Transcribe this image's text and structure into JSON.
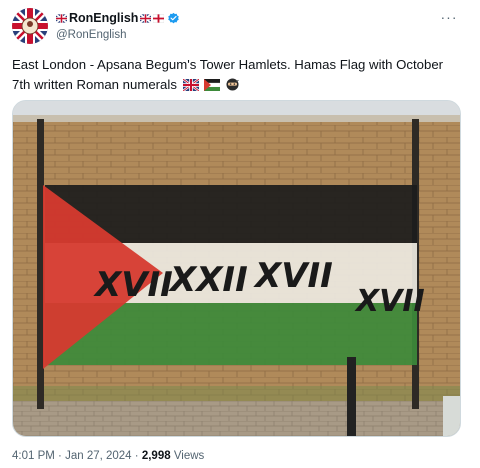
{
  "author": {
    "display_name": "RonEnglish",
    "handle": "@RonEnglish",
    "verified": true,
    "avatar_icon": "union-jack-avatar-icon"
  },
  "more_icon": "more-options-icon",
  "tweet": {
    "text": "East London - Apsana Begum's Tower Hamlets. Hamas Flag with October 7th written Roman numerals",
    "trailing_emojis": [
      "union-jack-flag-emoji",
      "palestine-flag-emoji",
      "ninja-emoji"
    ]
  },
  "media": {
    "graffiti_text": [
      "XVII",
      "XXII",
      "XVII",
      "XVII"
    ]
  },
  "meta": {
    "time": "4:01 PM",
    "separator": "·",
    "date": "Jan 27, 2024",
    "views_count": "2,998",
    "views_label": "Views"
  },
  "colors": {
    "verified_blue": "#1d9bf0",
    "secondary_text": "#536471",
    "flag_red": "#d63a2f",
    "flag_black": "#1c1c1c",
    "flag_white": "#ece8e0",
    "flag_green": "#3d8a3a"
  }
}
